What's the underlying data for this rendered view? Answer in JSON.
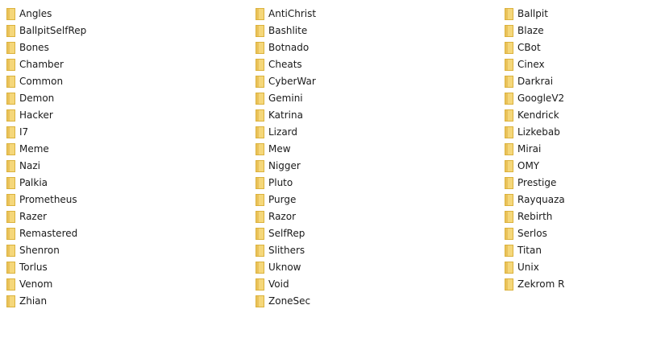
{
  "icons": {
    "folder": "folder-icon"
  },
  "colors": {
    "folder_fill": "#f5d77a",
    "folder_edge": "#dbb23d",
    "folder_tab": "#eac25a",
    "text": "#1a1a1a"
  },
  "columns": [
    {
      "items": [
        {
          "name": "Angles"
        },
        {
          "name": "BallpitSelfRep"
        },
        {
          "name": "Bones"
        },
        {
          "name": "Chamber"
        },
        {
          "name": "Common"
        },
        {
          "name": "Demon"
        },
        {
          "name": "Hacker"
        },
        {
          "name": "I7"
        },
        {
          "name": "Meme"
        },
        {
          "name": "Nazi"
        },
        {
          "name": "Palkia"
        },
        {
          "name": "Prometheus"
        },
        {
          "name": "Razer"
        },
        {
          "name": "Remastered"
        },
        {
          "name": "Shenron"
        },
        {
          "name": "Torlus"
        },
        {
          "name": "Venom"
        },
        {
          "name": "Zhian"
        }
      ]
    },
    {
      "items": [
        {
          "name": "AntiChrist"
        },
        {
          "name": "Bashlite"
        },
        {
          "name": "Botnado"
        },
        {
          "name": "Cheats"
        },
        {
          "name": "CyberWar"
        },
        {
          "name": "Gemini"
        },
        {
          "name": "Katrina"
        },
        {
          "name": "Lizard"
        },
        {
          "name": "Mew"
        },
        {
          "name": "Nigger"
        },
        {
          "name": "Pluto"
        },
        {
          "name": "Purge"
        },
        {
          "name": "Razor"
        },
        {
          "name": "SelfRep"
        },
        {
          "name": "Slithers"
        },
        {
          "name": "Uknow"
        },
        {
          "name": "Void"
        },
        {
          "name": "ZoneSec"
        }
      ]
    },
    {
      "items": [
        {
          "name": "Ballpit"
        },
        {
          "name": "Blaze"
        },
        {
          "name": "CBot"
        },
        {
          "name": "Cinex"
        },
        {
          "name": "Darkrai"
        },
        {
          "name": "GoogleV2"
        },
        {
          "name": "Kendrick"
        },
        {
          "name": "Lizkebab"
        },
        {
          "name": "Mirai"
        },
        {
          "name": "OMY"
        },
        {
          "name": "Prestige"
        },
        {
          "name": "Rayquaza"
        },
        {
          "name": "Rebirth"
        },
        {
          "name": "Serlos"
        },
        {
          "name": "Titan"
        },
        {
          "name": "Unix"
        },
        {
          "name": "Zekrom R"
        }
      ]
    }
  ]
}
